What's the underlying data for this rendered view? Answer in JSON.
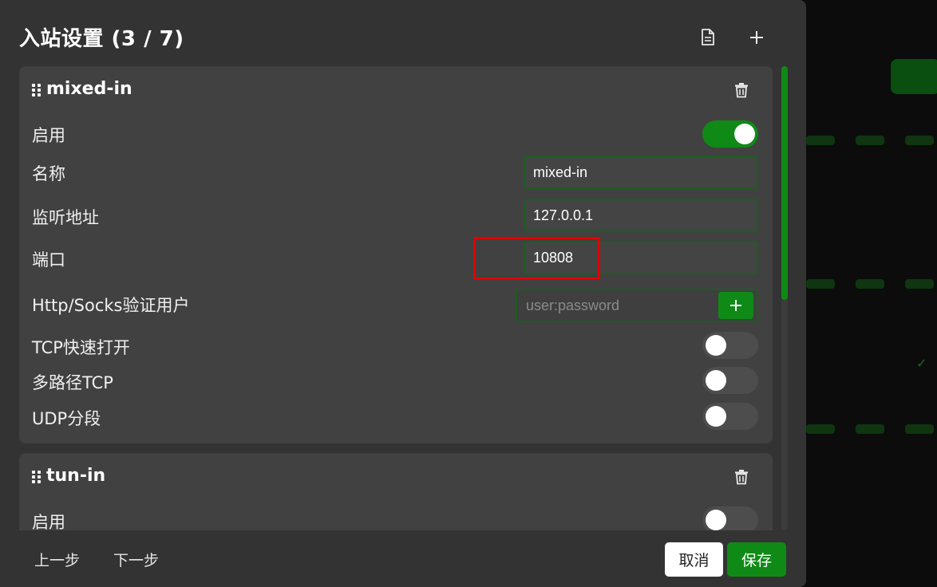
{
  "dialog": {
    "title": "入站设置 (3 / 7)",
    "icons": [
      "document-icon",
      "plus-icon"
    ]
  },
  "inbounds": [
    {
      "name": "mixed-in",
      "enabled": true,
      "fields": {
        "enable_label": "启用",
        "name_label": "名称",
        "name_value": "mixed-in",
        "listen_label": "监听地址",
        "listen_value": "127.0.0.1",
        "port_label": "端口",
        "port_value": "10808",
        "auth_label": "Http/Socks验证用户",
        "auth_placeholder": "user:password",
        "tcp_fast_open_label": "TCP快速打开",
        "tcp_fast_open": false,
        "multipath_tcp_label": "多路径TCP",
        "multipath_tcp": false,
        "udp_fragment_label": "UDP分段",
        "udp_fragment": false
      }
    },
    {
      "name": "tun-in",
      "enabled": false,
      "fields": {
        "enable_label": "启用"
      }
    }
  ],
  "footer": {
    "prev_label": "上一步",
    "next_label": "下一步",
    "cancel_label": "取消",
    "save_label": "保存"
  },
  "colors": {
    "accent": "#0f8a16",
    "modal_bg": "#333333",
    "card_bg": "#414141",
    "highlight": "#e00000"
  }
}
